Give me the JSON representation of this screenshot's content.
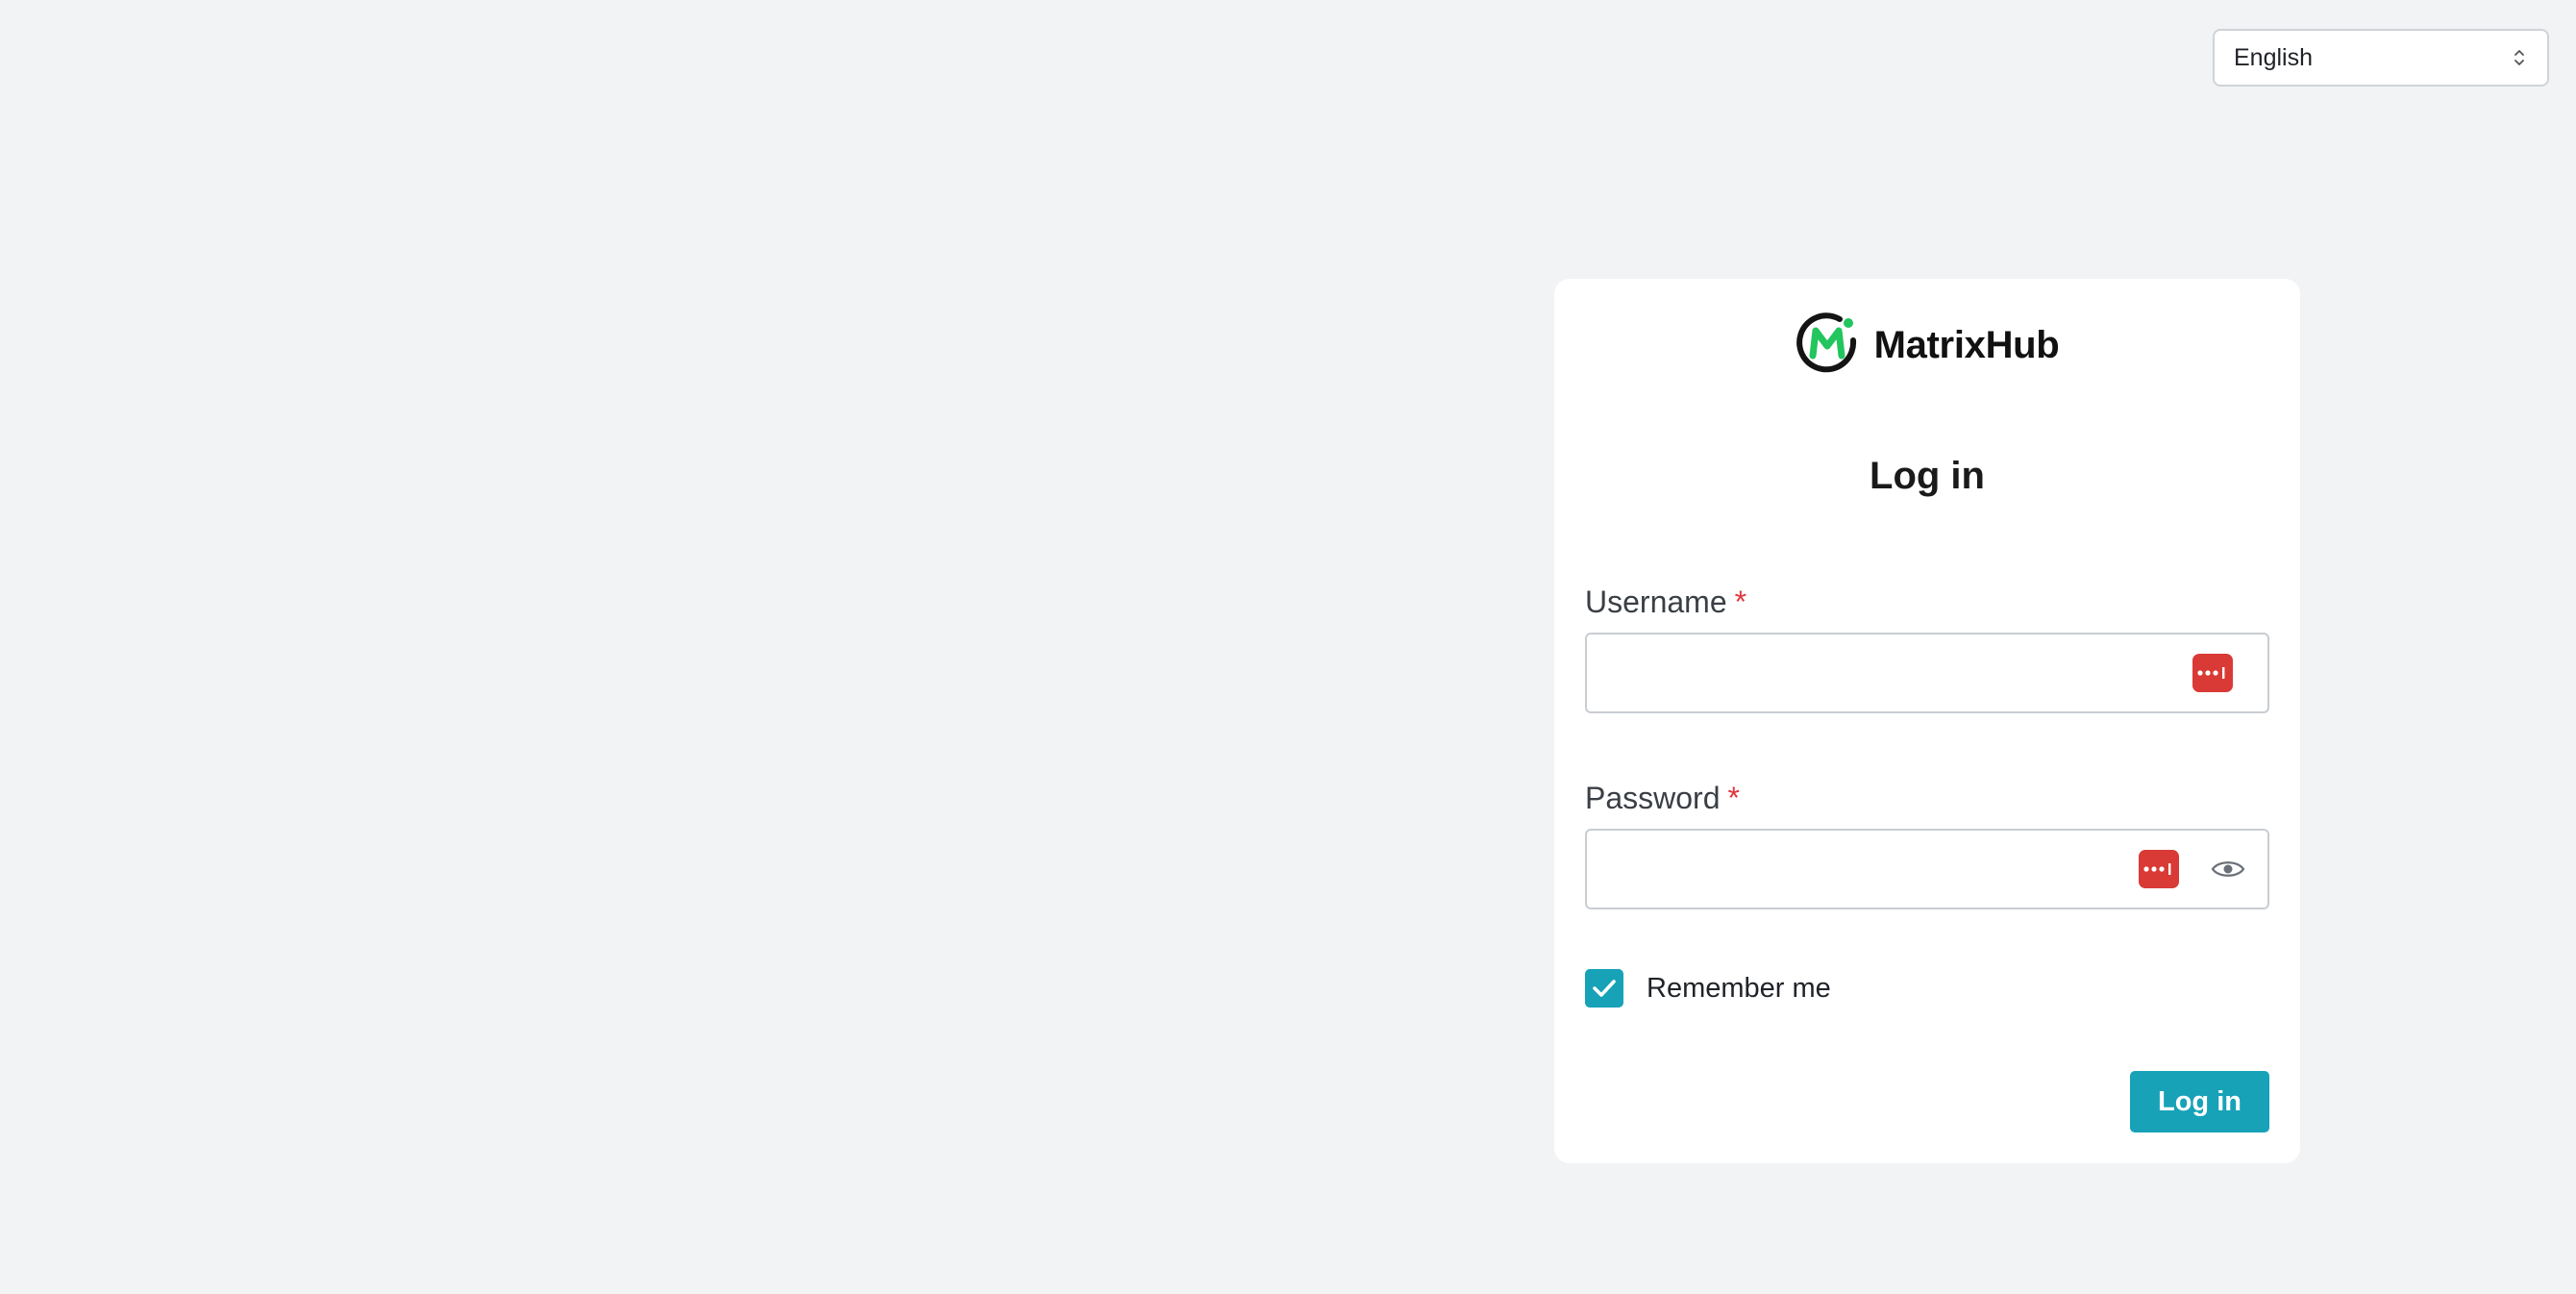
{
  "language": {
    "selected": "English"
  },
  "brand": {
    "name": "MatrixHub"
  },
  "form": {
    "title": "Log in",
    "username": {
      "label": "Username",
      "required_mark": "*",
      "value": ""
    },
    "password": {
      "label": "Password",
      "required_mark": "*",
      "value": ""
    },
    "remember": {
      "label": "Remember me",
      "checked": true
    },
    "submit_label": "Log in"
  },
  "icons": {
    "logo": "matrixhub-logo-icon",
    "password_manager": "password-manager-icon",
    "show_password": "eye-icon",
    "checkbox": "checkmark-icon",
    "select": "chevron-updown-icon"
  },
  "colors": {
    "accent": "#17a2b8",
    "required": "#e0383e",
    "password_manager": "#d93a35",
    "background": "#f2f3f5",
    "logo_green": "#22c55e"
  }
}
